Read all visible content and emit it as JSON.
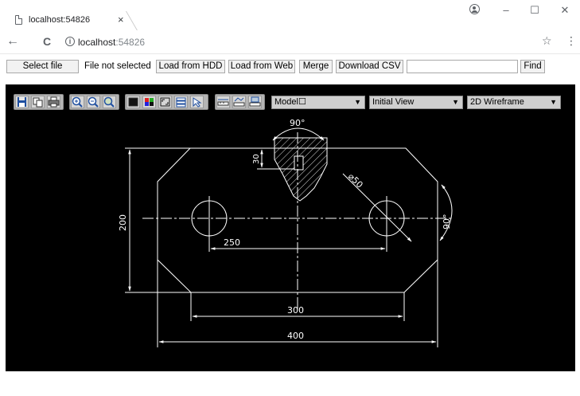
{
  "browser": {
    "tab_title": "localhost:54826",
    "tab_close": "×",
    "window_minimize": "–",
    "window_maximize": "☐",
    "window_close": "✕",
    "back": "←",
    "reload": "C",
    "url_host": "localhost",
    "url_port": ":54826",
    "info_glyph": "i",
    "star": "☆",
    "menu": "⋮"
  },
  "toolbar": {
    "select_file_label": "Select file",
    "file_status": "File not selected",
    "load_hdd_label": "Load from HDD",
    "load_web_label": "Load from Web",
    "merge_label": "Merge",
    "download_csv_label": "Download CSV",
    "search_value": "",
    "find_label": "Find"
  },
  "viewer": {
    "layout_select": "Model☐",
    "view_select": "Initial View",
    "style_select": "2D Wireframe",
    "background_color": "#000000",
    "drawing": {
      "angle_top": "90°",
      "angle_right": "90°",
      "dim_30": "30",
      "dim_200": "200",
      "dim_250": "250",
      "dim_300": "300",
      "dim_400": "400",
      "dim_diameter": "⌀50"
    }
  }
}
